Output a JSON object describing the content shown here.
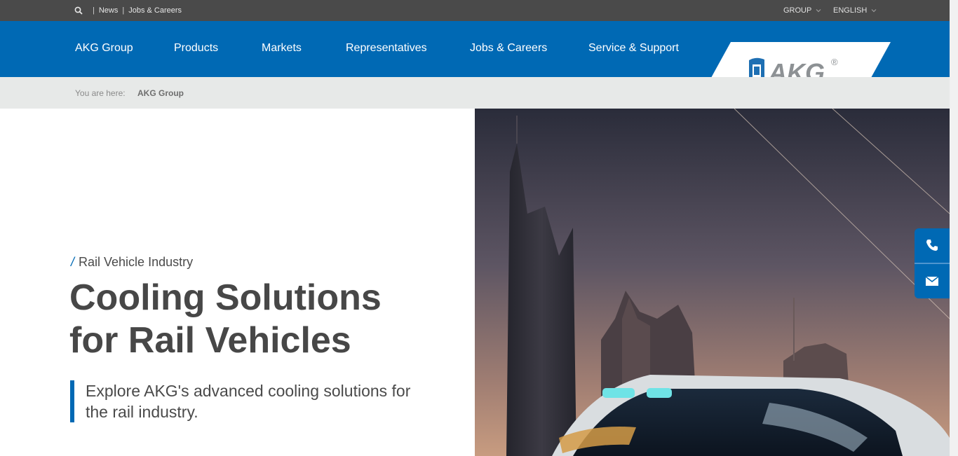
{
  "topbar": {
    "search_icon": "search-icon",
    "separator": "|",
    "links": [
      "News",
      "Jobs & Careers"
    ],
    "group_label": "GROUP",
    "language_label": "ENGLISH"
  },
  "nav": {
    "items": [
      "AKG Group",
      "Products",
      "Markets",
      "Representatives",
      "Jobs & Careers",
      "Service & Support"
    ],
    "logo_text": "AKG",
    "logo_registered": "®"
  },
  "breadcrumb": {
    "label": "You are here:",
    "current": "AKG Group"
  },
  "hero": {
    "kicker_slash": "/",
    "kicker": "Rail Vehicle Industry",
    "headline_line1": "Cooling Solutions",
    "headline_line2": "for Rail Vehicles",
    "intro": "Explore AKG's advanced cooling solutions for the rail industry."
  },
  "contact": {
    "phone_icon": "phone-icon",
    "mail_icon": "mail-icon"
  },
  "colors": {
    "brand_blue": "#0069b4",
    "topbar": "#4a4a4a",
    "breadcrumb_bg": "#e7e9e8",
    "text_dark": "#474747"
  }
}
